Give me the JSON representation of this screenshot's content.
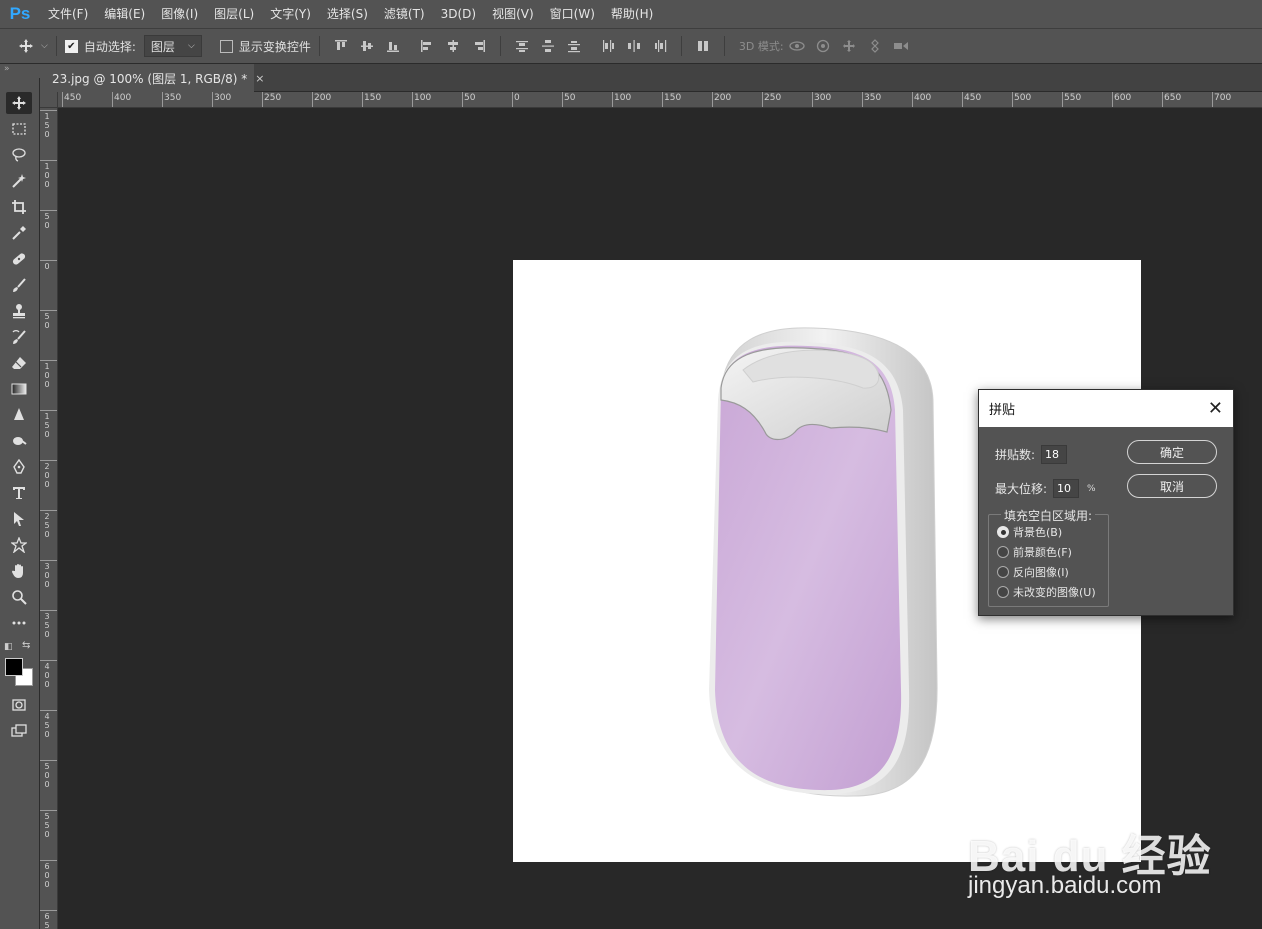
{
  "app": {
    "logo": "Ps"
  },
  "menu": [
    "文件(F)",
    "编辑(E)",
    "图像(I)",
    "图层(L)",
    "文字(Y)",
    "选择(S)",
    "滤镜(T)",
    "3D(D)",
    "视图(V)",
    "窗口(W)",
    "帮助(H)"
  ],
  "options": {
    "auto_select_label": "自动选择:",
    "auto_select_checked": true,
    "layer_select_value": "图层",
    "show_transform_label": "显示变换控件",
    "show_transform_checked": false,
    "mode_3d_label": "3D 模式:"
  },
  "tab": {
    "title": "23.jpg @ 100% (图层 1, RGB/8) *",
    "close": "×"
  },
  "ruler_h": [
    "450",
    "400",
    "350",
    "300",
    "250",
    "200",
    "150",
    "100",
    "50",
    "0",
    "50",
    "100",
    "150",
    "200",
    "250",
    "300",
    "350",
    "400",
    "450",
    "500",
    "550",
    "600",
    "650",
    "700"
  ],
  "ruler_v": [
    "150",
    "100",
    "50",
    "0",
    "50",
    "100",
    "150",
    "200",
    "250",
    "300",
    "350",
    "400",
    "450",
    "500",
    "550",
    "600",
    "65"
  ],
  "colors": {
    "product_body": "#d3b6df",
    "product_shell": "#e6e6e6",
    "accent": "#31a8ff"
  },
  "dialog": {
    "title": "拼贴",
    "close": "✕",
    "tiles_label": "拼贴数:",
    "tiles_value": "18",
    "offset_label": "最大位移:",
    "offset_value": "10",
    "offset_unit": "%",
    "ok_label": "确定",
    "cancel_label": "取消",
    "fill_legend": "填充空白区域用:",
    "options": [
      "背景色(B)",
      "前景颜色(F)",
      "反向图像(I)",
      "未改变的图像(U)"
    ],
    "selected_option": 0
  },
  "watermark": {
    "logo": "Bai du 经验",
    "url": "jingyan.baidu.com"
  }
}
